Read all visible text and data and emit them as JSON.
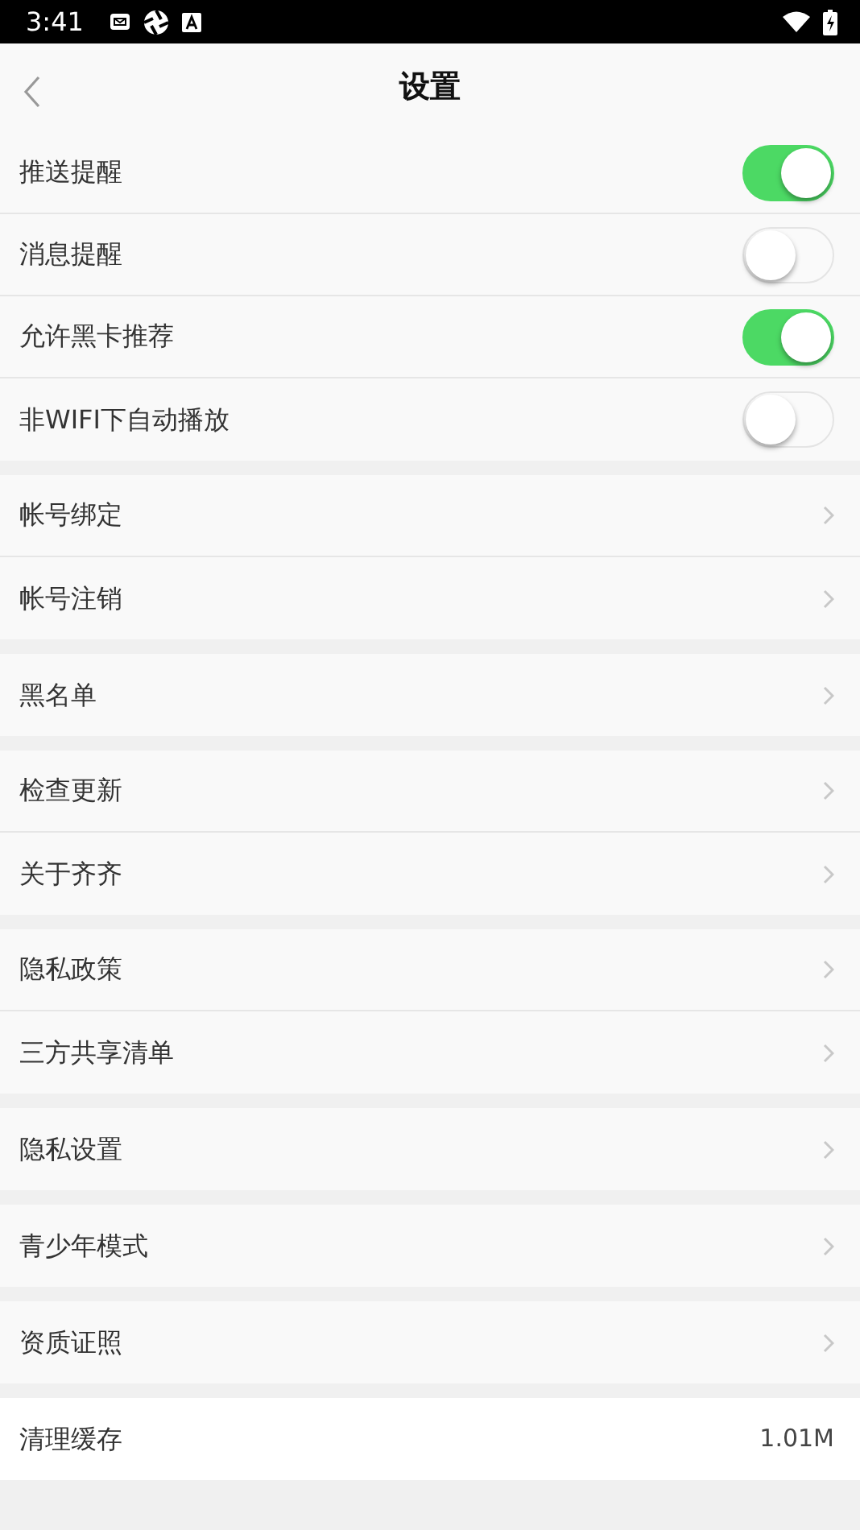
{
  "status_bar": {
    "time": "3:41"
  },
  "header": {
    "title": "设置"
  },
  "toggles": [
    {
      "label": "推送提醒",
      "on": true
    },
    {
      "label": "消息提醒",
      "on": false
    },
    {
      "label": "允许黑卡推荐",
      "on": true
    },
    {
      "label": "非WIFI下自动播放",
      "on": false
    }
  ],
  "groups": [
    {
      "items": [
        {
          "label": "帐号绑定",
          "kind": "link"
        },
        {
          "label": "帐号注销",
          "kind": "link"
        }
      ]
    },
    {
      "items": [
        {
          "label": "黑名单",
          "kind": "link"
        }
      ]
    },
    {
      "items": [
        {
          "label": "检查更新",
          "kind": "link"
        },
        {
          "label": "关于齐齐",
          "kind": "link"
        }
      ]
    },
    {
      "items": [
        {
          "label": "隐私政策",
          "kind": "link"
        },
        {
          "label": "三方共享清单",
          "kind": "link"
        }
      ]
    },
    {
      "items": [
        {
          "label": "隐私设置",
          "kind": "link"
        }
      ]
    },
    {
      "items": [
        {
          "label": "青少年模式",
          "kind": "link"
        }
      ]
    },
    {
      "items": [
        {
          "label": "资质证照",
          "kind": "link"
        }
      ]
    },
    {
      "items": [
        {
          "label": "清理缓存",
          "kind": "value",
          "value": "1.01M"
        }
      ]
    }
  ]
}
